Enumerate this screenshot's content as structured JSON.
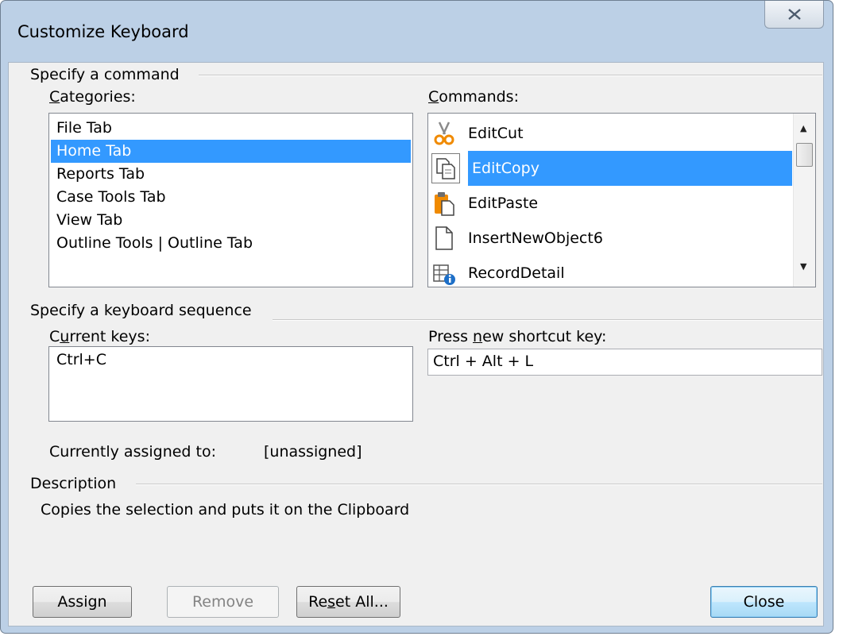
{
  "window": {
    "title": "Customize Keyboard"
  },
  "specify_command": {
    "group_label": "Specify a command",
    "categories": {
      "label": "Categories:",
      "items": [
        "File Tab",
        "Home Tab",
        "Reports Tab",
        "Case Tools Tab",
        "View Tab",
        "Outline Tools | Outline Tab"
      ],
      "selected": "Home Tab"
    },
    "commands": {
      "label": "Commands:",
      "items": [
        {
          "label": "EditCut",
          "icon": "scissors-icon"
        },
        {
          "label": "EditCopy",
          "icon": "copy-icon"
        },
        {
          "label": "EditPaste",
          "icon": "paste-icon"
        },
        {
          "label": "InsertNewObject6",
          "icon": "new-document-icon"
        },
        {
          "label": "RecordDetail",
          "icon": "record-detail-icon"
        }
      ],
      "selected": "EditCopy"
    }
  },
  "keyboard_sequence": {
    "group_label": "Specify a keyboard sequence",
    "current_keys_label": "Current keys:",
    "current_keys": [
      "Ctrl+C"
    ],
    "new_shortcut_label": "Press new shortcut key:",
    "new_shortcut_value": "Ctrl + Alt + L",
    "assigned_label": "Currently assigned to:",
    "assigned_value": "[unassigned]"
  },
  "description": {
    "group_label": "Description",
    "text": "Copies the selection and puts it on the Clipboard"
  },
  "buttons": {
    "assign": "Assign",
    "remove": "Remove",
    "reset_all": "Reset All...",
    "close": "Close"
  },
  "colors": {
    "selection": "#3399ff",
    "window_frame": "#bcd0e6",
    "client_bg": "#f0f0f0"
  }
}
